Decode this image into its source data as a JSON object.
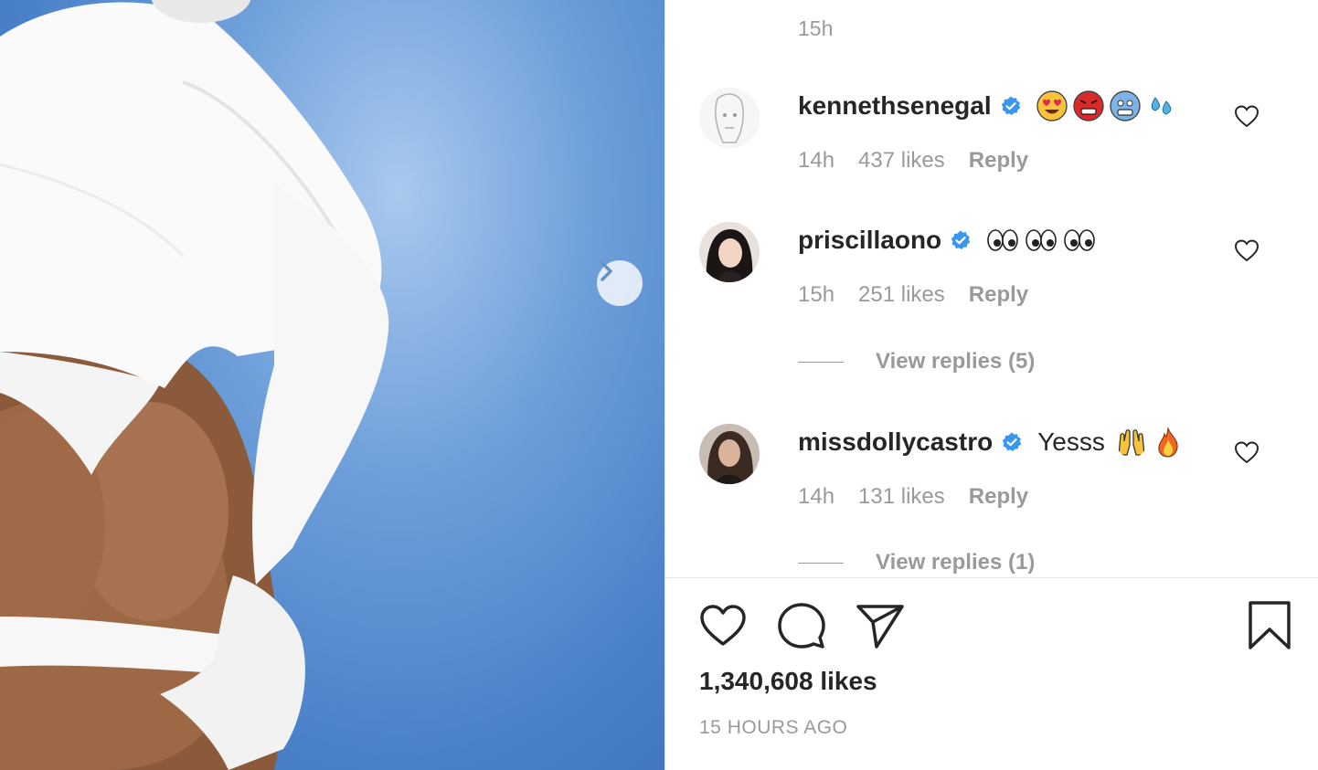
{
  "post": {
    "likes_text": "1,340,608 likes",
    "posted_time": "15 HOURS AGO"
  },
  "comments_panel": {
    "top_timestamp": "15h",
    "comments": [
      {
        "username": "kennethsenegal",
        "verified": true,
        "text": "",
        "emojis": [
          "heart-eyes-emoji",
          "angry-face-emoji",
          "cold-face-emoji",
          "sweat-droplets-emoji"
        ],
        "time": "14h",
        "likes": "437 likes",
        "reply_label": "Reply"
      },
      {
        "username": "priscillaono",
        "verified": true,
        "text": "",
        "emojis": [
          "eyes-emoji",
          "eyes-emoji",
          "eyes-emoji"
        ],
        "time": "15h",
        "likes": "251 likes",
        "reply_label": "Reply",
        "view_replies": "View replies (5)"
      },
      {
        "username": "missdollycastro",
        "verified": true,
        "text": "Yesss",
        "emojis": [
          "raising-hands-emoji",
          "fire-emoji"
        ],
        "time": "14h",
        "likes": "131 likes",
        "reply_label": "Reply",
        "view_replies": "View replies (1)"
      }
    ]
  },
  "colors": {
    "verified_blue": "#3897f0",
    "text_primary": "#262626",
    "text_secondary": "#9a9a9a"
  }
}
